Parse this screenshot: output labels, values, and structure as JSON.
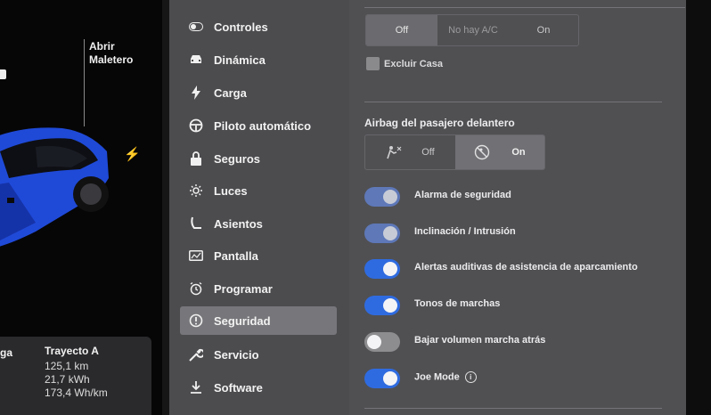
{
  "car_panel": {
    "trunk_label_line1": "Abrir",
    "trunk_label_line2": "Maletero",
    "trip": {
      "col1_header": "ga",
      "col2_header": "Trayecto A",
      "distance": "125,1 km",
      "energy": "21,7 kWh",
      "efficiency": "173,4 Wh/km"
    }
  },
  "nav": {
    "items": [
      {
        "label": "Controles",
        "icon": "toggle-icon"
      },
      {
        "label": "Dinámica",
        "icon": "car-icon"
      },
      {
        "label": "Carga",
        "icon": "bolt-icon"
      },
      {
        "label": "Piloto automático",
        "icon": "steering-wheel-icon"
      },
      {
        "label": "Seguros",
        "icon": "lock-icon"
      },
      {
        "label": "Luces",
        "icon": "light-icon"
      },
      {
        "label": "Asientos",
        "icon": "seat-icon"
      },
      {
        "label": "Pantalla",
        "icon": "display-icon"
      },
      {
        "label": "Programar",
        "icon": "alarm-clock-icon"
      },
      {
        "label": "Seguridad",
        "icon": "info-circle-icon"
      },
      {
        "label": "Servicio",
        "icon": "wrench-icon"
      },
      {
        "label": "Software",
        "icon": "download-icon"
      }
    ],
    "active": "Seguridad"
  },
  "content": {
    "ac_segment": {
      "options": [
        "Off",
        "No hay A/C",
        "On"
      ],
      "selected": "Off"
    },
    "exclude_home_label": "Excluir Casa",
    "airbag": {
      "title": "Airbag del pasajero delantero",
      "off_label": "Off",
      "on_label": "On",
      "selected": "On"
    },
    "toggles": [
      {
        "label": "Alarma de seguridad",
        "state": "on-dim"
      },
      {
        "label": "Inclinación / Intrusión",
        "state": "on-dim"
      },
      {
        "label": "Alertas auditivas de asistencia de aparcamiento",
        "state": "on"
      },
      {
        "label": "Tonos de marchas",
        "state": "on"
      },
      {
        "label": "Bajar volumen marcha atrás",
        "state": "off"
      },
      {
        "label": "Joe Mode",
        "state": "on",
        "info": "i"
      }
    ]
  },
  "colors": {
    "accent": "#2f6be0",
    "panel": "#505053",
    "nav": "#4c4c4f",
    "car_blue": "#1f4ad8"
  }
}
